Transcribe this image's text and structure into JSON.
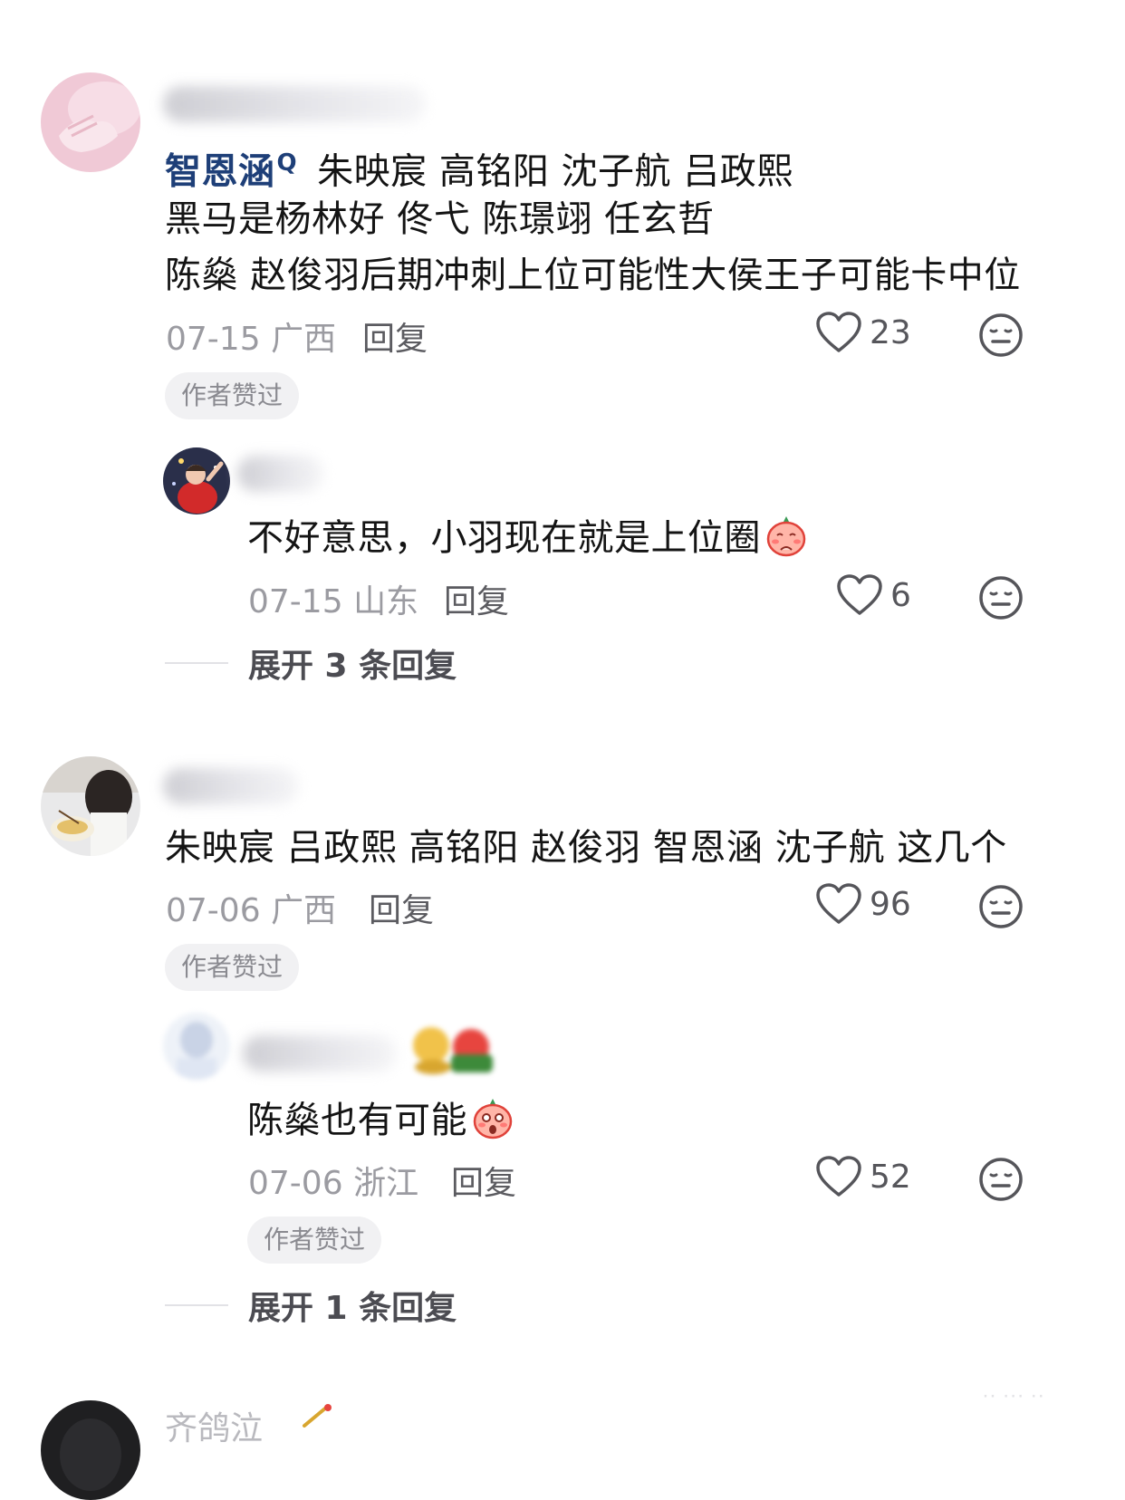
{
  "comments": [
    {
      "text_mention": "智恩涵",
      "text_line1_rest": "朱映宸 高铭阳 沈子航 吕政熙",
      "text_line2": "黑马是杨林好 佟弋 陈璟翊 任玄哲",
      "text_line3": "陈燊 赵俊羽后期冲刺上位可能性大侯王子可能卡中位",
      "date": "07-15",
      "location": "广西",
      "reply_label": "回复",
      "likes": "23",
      "badge": "作者赞过",
      "reply": {
        "text": "不好意思，小羽现在就是上位圈",
        "date": "07-15",
        "location": "山东",
        "reply_label": "回复",
        "likes": "6"
      },
      "expand_label": "展开 3 条回复"
    },
    {
      "text": "朱映宸 吕政熙 高铭阳 赵俊羽 智恩涵 沈子航 这几个",
      "date": "07-06",
      "location": "广西",
      "reply_label": "回复",
      "likes": "96",
      "badge": "作者赞过",
      "reply": {
        "text": "陈燊也有可能",
        "date": "07-06",
        "location": "浙江",
        "reply_label": "回复",
        "likes": "52",
        "badge": "作者赞过"
      },
      "expand_label": "展开 1 条回复"
    }
  ],
  "third_comment": {
    "username_partial": "齐鸽泣"
  },
  "colors": {
    "mention": "#1e3f78",
    "meta": "#9b9ba1",
    "badge_bg": "#f1f1f3"
  }
}
